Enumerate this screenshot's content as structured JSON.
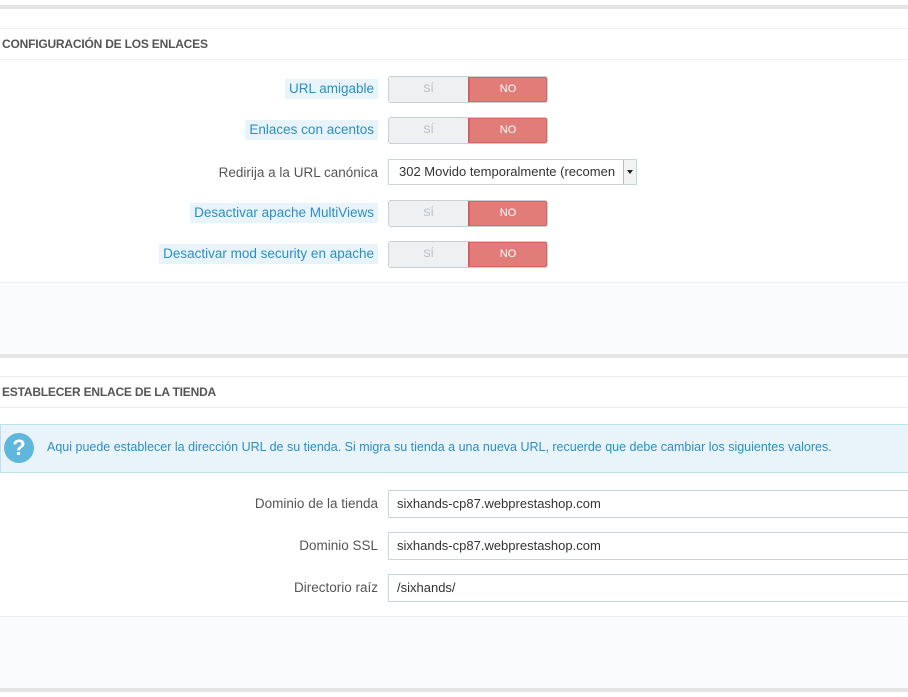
{
  "section1": {
    "title": "CONFIGURACIÓN DE LOS ENLACES",
    "rows": [
      {
        "label": "URL amigable",
        "yes": "SÍ",
        "no": "NO",
        "value": "NO"
      },
      {
        "label": "Enlaces con acentos",
        "yes": "SÍ",
        "no": "NO",
        "value": "NO"
      },
      {
        "label": "Redirija a la URL canónica",
        "select": "302 Movido temporalmente (recomen"
      },
      {
        "label": "Desactivar apache MultiViews",
        "yes": "SÍ",
        "no": "NO",
        "value": "NO"
      },
      {
        "label": "Desactivar mod security en apache",
        "yes": "SÍ",
        "no": "NO",
        "value": "NO"
      }
    ]
  },
  "section2": {
    "title": "ESTABLECER ENLACE DE LA TIENDA",
    "info_icon": "question-icon",
    "info": "Aqui puede establecer la dirección URL de su tienda. Si migra su tienda a una nueva URL, recuerde que debe cambiar los siguientes valores.",
    "fields": [
      {
        "label": "Dominio de la tienda",
        "value": "sixhands-cp87.webprestashop.com"
      },
      {
        "label": "Dominio SSL",
        "value": "sixhands-cp87.webprestashop.com"
      },
      {
        "label": "Directorio raíz",
        "value": "/sixhands/"
      }
    ]
  },
  "colors": {
    "switch_on": "#e27c79",
    "hint_text": "#2c8ec2",
    "hint_bg": "#e9f4fa"
  }
}
